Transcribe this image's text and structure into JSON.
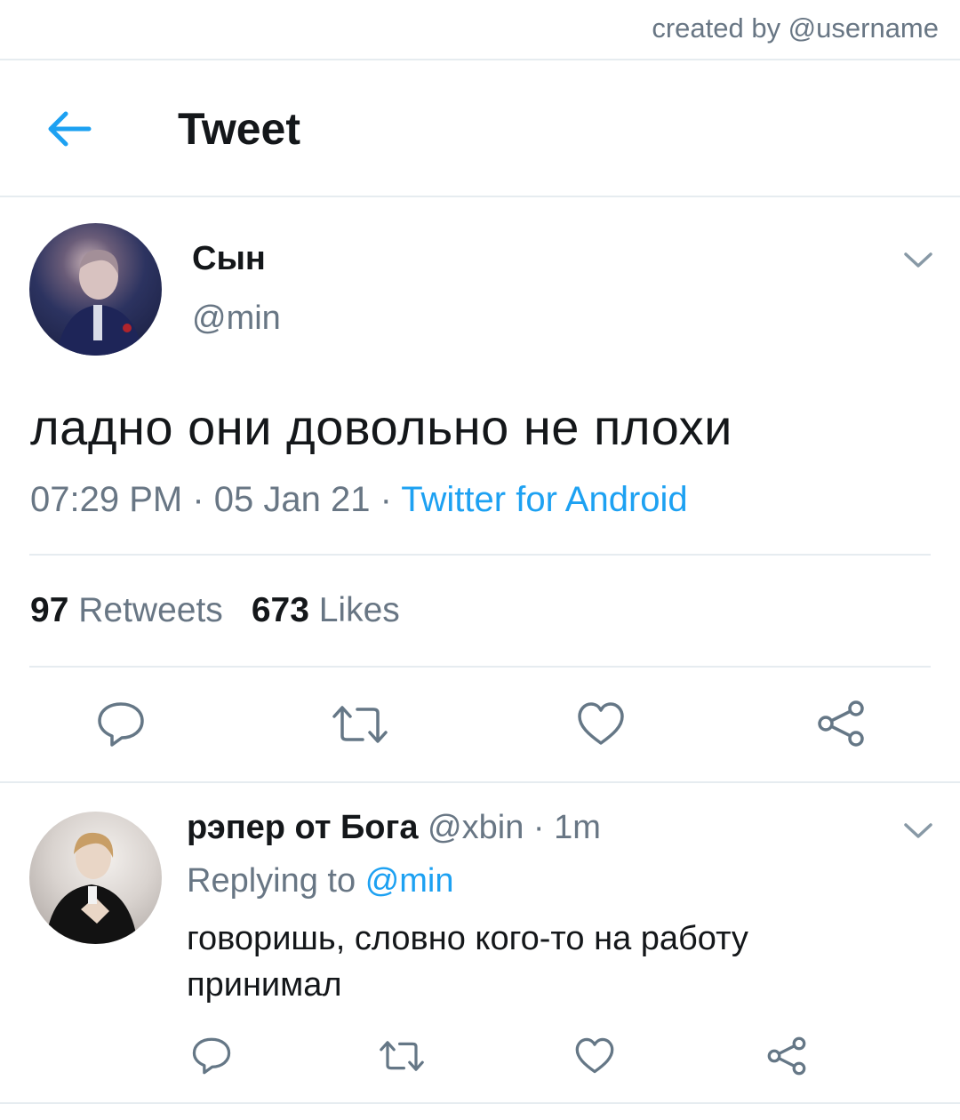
{
  "credit": "created by @username",
  "header": {
    "title": "Tweet"
  },
  "tweet": {
    "author_name": "Сын",
    "author_handle": "@min",
    "text": "ладно они довольно не плохи",
    "time": "07:29 PM",
    "date": "05 Jan 21",
    "separator": " · ",
    "source": "Twitter for Android",
    "retweets_count": "97",
    "retweets_label": "Retweets",
    "likes_count": "673",
    "likes_label": "Likes"
  },
  "reply": {
    "author_name": "рэпер от Бога",
    "author_handle": "@xbin",
    "separator": " · ",
    "time": "1m",
    "replying_label": "Replying to",
    "replying_to": "@min",
    "text": "говоришь, словно кого-то на работу принимал"
  },
  "colors": {
    "accent": "#1da1f2",
    "muted": "#687684",
    "divider": "#e6ecf0",
    "text": "#14171a"
  },
  "icons": [
    "back-arrow-icon",
    "chevron-down-icon",
    "reply-icon",
    "retweet-icon",
    "like-icon",
    "share-icon"
  ]
}
